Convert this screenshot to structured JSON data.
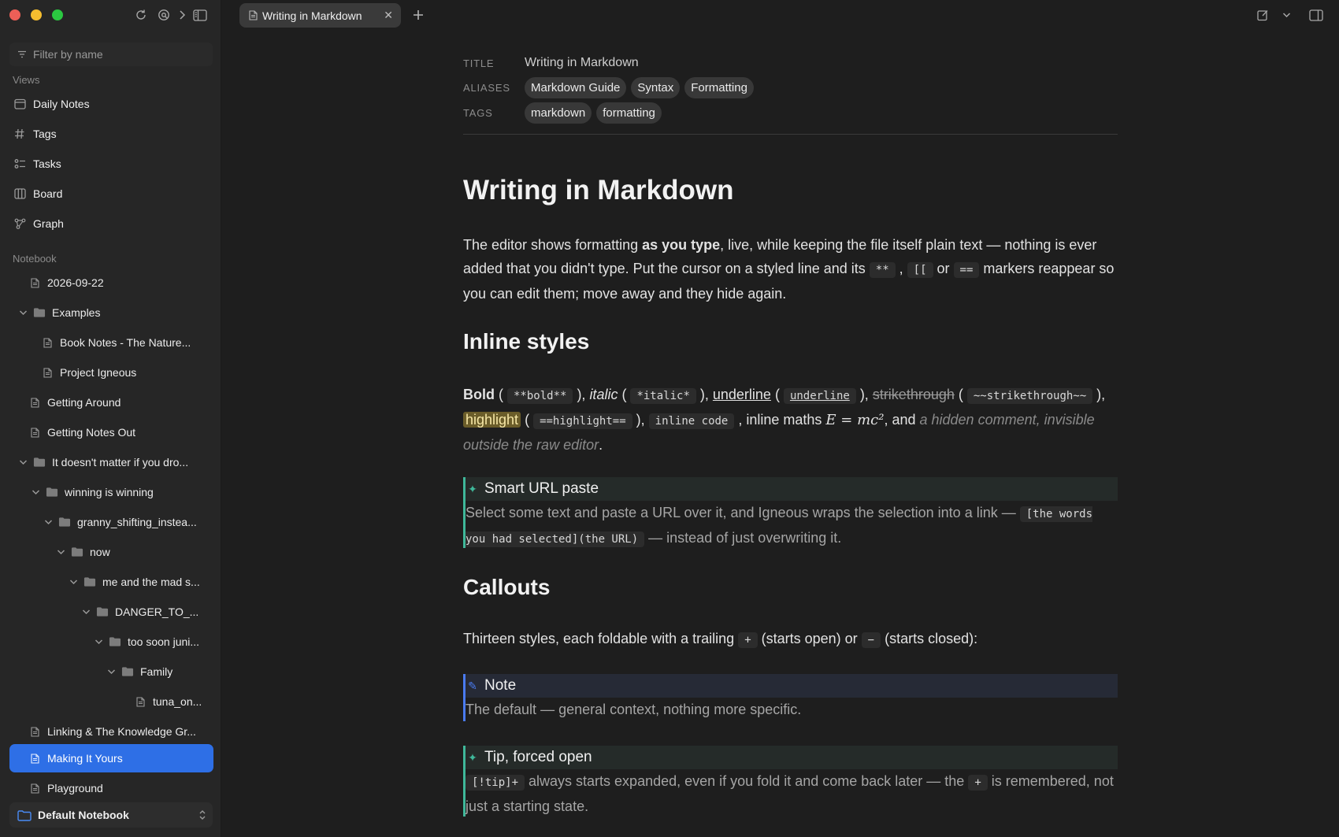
{
  "window": {
    "tab_title": "Writing in Markdown"
  },
  "sidebar": {
    "filter_placeholder": "Filter by name",
    "views_label": "Views",
    "views": [
      {
        "label": "Daily Notes",
        "icon": "calendar-icon"
      },
      {
        "label": "Tags",
        "icon": "hash-icon"
      },
      {
        "label": "Tasks",
        "icon": "tasks-icon"
      },
      {
        "label": "Board",
        "icon": "board-icon"
      },
      {
        "label": "Graph",
        "icon": "graph-icon"
      }
    ],
    "notebook_label": "Notebook",
    "tree": [
      {
        "label": "2026-09-22",
        "type": "file"
      },
      {
        "label": "Examples",
        "type": "folder"
      },
      {
        "label": "Book Notes - The Nature...",
        "type": "file"
      },
      {
        "label": "Project Igneous",
        "type": "file"
      },
      {
        "label": "Getting Around",
        "type": "file"
      },
      {
        "label": "Getting Notes Out",
        "type": "file"
      },
      {
        "label": "It doesn't matter if you dro...",
        "type": "folder"
      },
      {
        "label": "winning is winning",
        "type": "folder"
      },
      {
        "label": "granny_shifting_instea...",
        "type": "folder"
      },
      {
        "label": "now",
        "type": "folder"
      },
      {
        "label": "me and the mad s...",
        "type": "folder"
      },
      {
        "label": "DANGER_TO_...",
        "type": "folder"
      },
      {
        "label": "too soon juni...",
        "type": "folder"
      },
      {
        "label": "Family",
        "type": "folder"
      },
      {
        "label": "tuna_on...",
        "type": "file"
      },
      {
        "label": "Linking & The Knowledge Gr...",
        "type": "file"
      },
      {
        "label": "Making It Yours",
        "type": "file",
        "selected": true
      },
      {
        "label": "Playground",
        "type": "file"
      }
    ],
    "notebook_switcher": "Default Notebook"
  },
  "properties": {
    "title_key": "TITLE",
    "title_value": "Writing in Markdown",
    "aliases_key": "ALIASES",
    "aliases": [
      "Markdown Guide",
      "Syntax",
      "Formatting"
    ],
    "tags_key": "TAGS",
    "tags": [
      "markdown",
      "formatting"
    ]
  },
  "doc": {
    "title": "Writing in Markdown",
    "intro": {
      "t1": "The editor shows formatting ",
      "bold": "as you type",
      "t2": ", live, while keeping the file itself plain text — nothing is ever added that you didn't type. Put the cursor on a styled line and its ",
      "c1": "**",
      "t3": " , ",
      "c2": "[[",
      "t4": " or ",
      "c3": "==",
      "t5": " markers reappear so you can edit them; move away and they hide again."
    },
    "h_inline": "Inline styles",
    "inline": {
      "bold": "Bold",
      "p1": " ( ",
      "c_bold": "**bold**",
      "p2": " ), ",
      "italic": "italic",
      "p3": " ( ",
      "c_italic": "*italic*",
      "p4": " ), ",
      "underline": "underline",
      "p5": " ( ",
      "c_underline": "underline",
      "p6": " ), ",
      "strike": "strikethrough",
      "p7": " ( ",
      "c_strike": "~~strikethrough~~",
      "p8": " ), ",
      "highlight": "highlight",
      "p9": " ( ",
      "c_highlight": "==highlight==",
      "p10": " ), ",
      "c_code": "inline code",
      "p11": " , inline maths ",
      "math": "E = mc²",
      "p12": ", and ",
      "comment": "a hidden comment, invisible outside the raw editor",
      "p13": "."
    },
    "callout_url": {
      "title": "Smart URL paste",
      "b1": "Select some text and paste a URL over it, and Igneous wraps the selection into a link — ",
      "c1": "[the words you had selected](the URL)",
      "b2": " — instead of just overwriting it."
    },
    "h_callouts": "Callouts",
    "callouts_intro": {
      "t1": "Thirteen styles, each foldable with a trailing ",
      "c1": "+",
      "t2": " (starts open) or ",
      "c2": "−",
      "t3": " (starts closed):"
    },
    "callout_note": {
      "title": "Note",
      "body": "The default — general context, nothing more specific."
    },
    "callout_tip": {
      "title": "Tip, forced open",
      "c1": "[!tip]+",
      "b1": " always starts expanded, even if you fold it and come back later — the ",
      "c2": "+",
      "b2": " is remembered, not just a starting state."
    }
  },
  "colors": {
    "accent": "#2e6fe6",
    "tip_callout": "#3fb89a",
    "note_callout": "#4a7bf0",
    "highlight": "#6b5d2a"
  }
}
